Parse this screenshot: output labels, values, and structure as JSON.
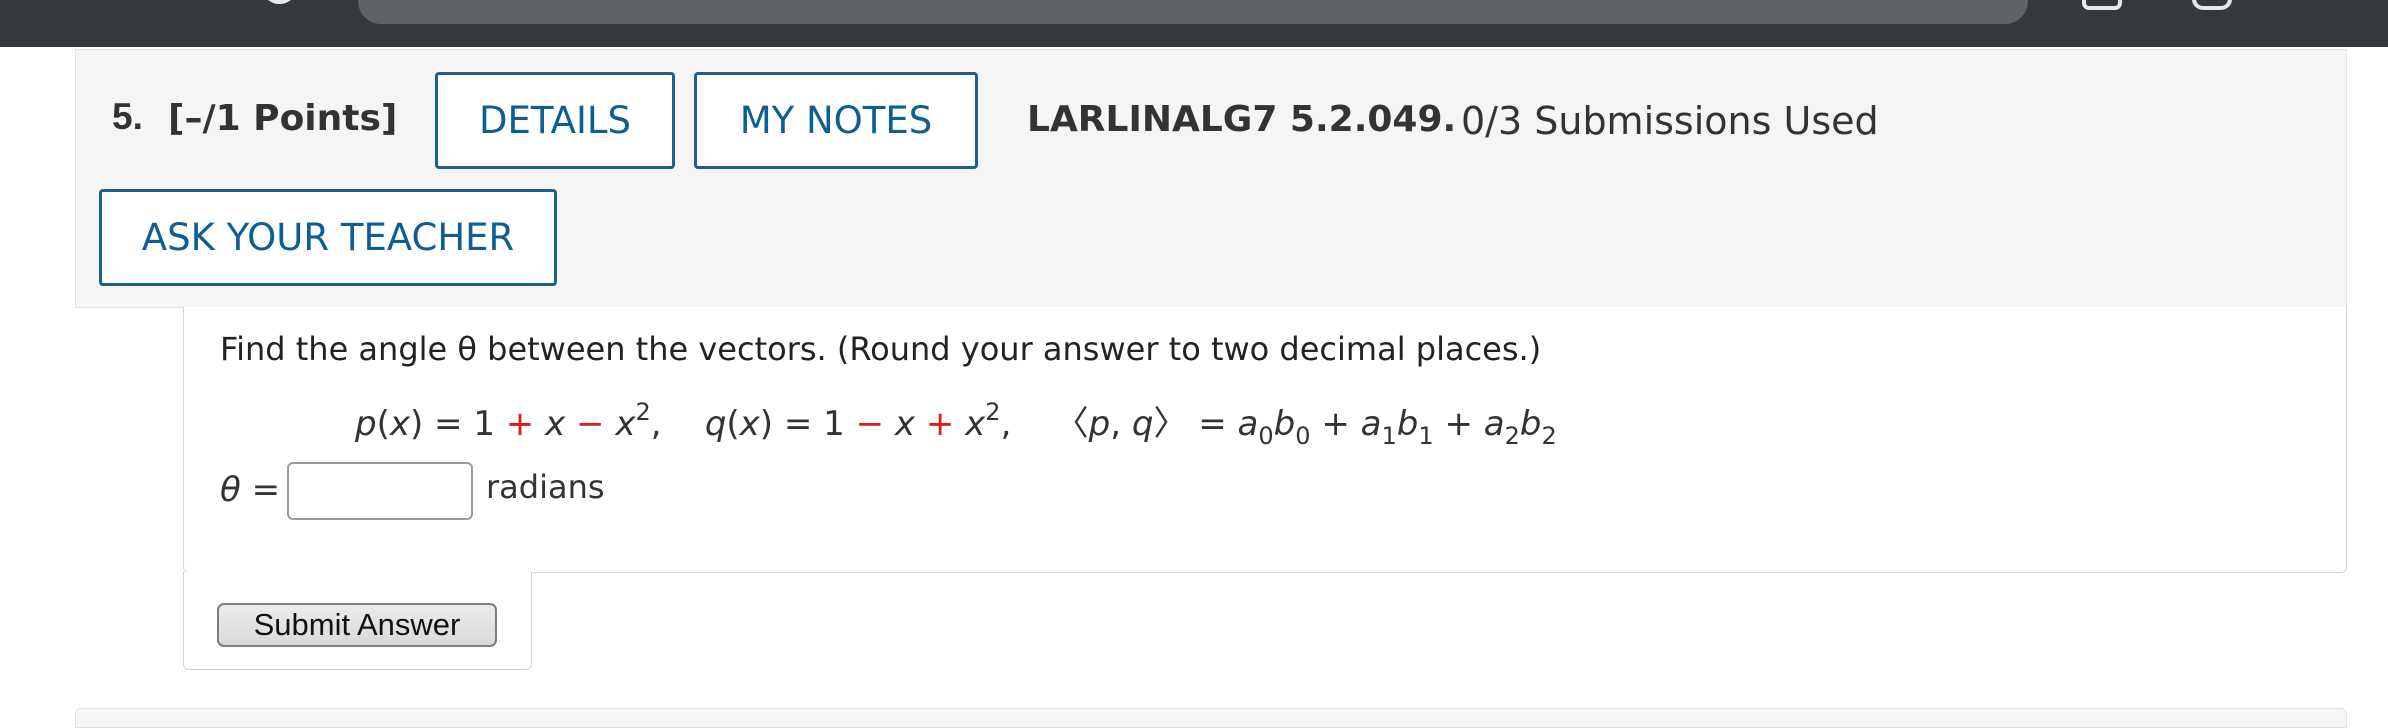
{
  "question": {
    "number": "5.",
    "points": "[–/1 Points]",
    "details_label": "DETAILS",
    "my_notes_label": "MY NOTES",
    "assignment_code": "LARLINALG7 5.2.049.",
    "submissions": "0/3 Submissions Used",
    "ask_teacher_label": "ASK YOUR TEACHER"
  },
  "prompt": "Find the angle θ between the vectors. (Round your answer to two decimal places.)",
  "answer": {
    "theta_label": "θ =",
    "value": "",
    "units": "radians"
  },
  "submit_label": "Submit Answer",
  "colors": {
    "accent": "#0c5e93",
    "operator_red": "#e01b1b",
    "header_bg": "#f5f5f5",
    "browser_bar": "#35393e"
  },
  "icons": [
    "back-arrow-icon",
    "forward-arrow-icon",
    "reload-icon",
    "tab-icon",
    "window-icon"
  ]
}
